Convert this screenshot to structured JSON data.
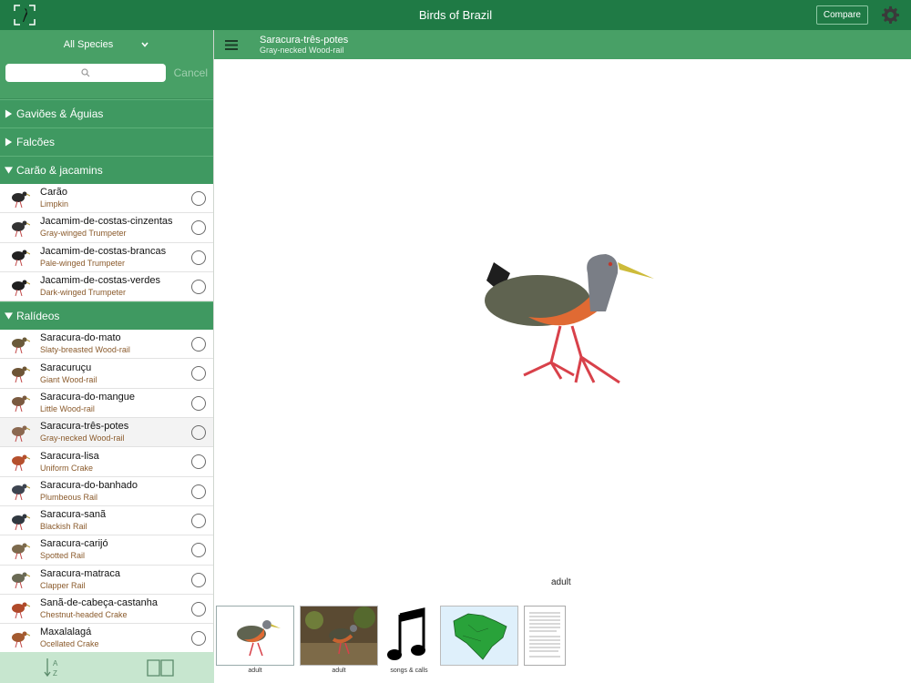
{
  "header": {
    "title": "Birds of Brazil",
    "compare_label": "Compare"
  },
  "sidebar": {
    "filter_label": "All Species",
    "search_placeholder": "",
    "cancel_label": "Cancel",
    "groups": [
      {
        "label": "Gaviões & Águias",
        "expanded": false,
        "items": []
      },
      {
        "label": "Falcões",
        "expanded": false,
        "items": []
      },
      {
        "label": "Carão & jacamins",
        "expanded": true,
        "items": [
          {
            "pt": "Carão",
            "en": "Limpkin"
          },
          {
            "pt": "Jacamim-de-costas-cinzentas",
            "en": "Gray-winged Trumpeter"
          },
          {
            "pt": "Jacamim-de-costas-brancas",
            "en": "Pale-winged Trumpeter"
          },
          {
            "pt": "Jacamim-de-costas-verdes",
            "en": "Dark-winged Trumpeter"
          }
        ]
      },
      {
        "label": "Ralídeos",
        "expanded": true,
        "items": [
          {
            "pt": "Saracura-do-mato",
            "en": "Slaty-breasted Wood-rail"
          },
          {
            "pt": "Saracuruçu",
            "en": "Giant Wood-rail"
          },
          {
            "pt": "Saracura-do-mangue",
            "en": "Little Wood-rail"
          },
          {
            "pt": "Saracura-três-potes",
            "en": "Gray-necked Wood-rail",
            "selected": true
          },
          {
            "pt": "Saracura-lisa",
            "en": "Uniform Crake"
          },
          {
            "pt": "Saracura-do-banhado",
            "en": "Plumbeous Rail"
          },
          {
            "pt": "Saracura-sanã",
            "en": "Blackish Rail"
          },
          {
            "pt": "Saracura-carijó",
            "en": "Spotted Rail"
          },
          {
            "pt": "Saracura-matraca",
            "en": "Clapper Rail"
          },
          {
            "pt": "Sanã-de-cabeça-castanha",
            "en": "Chestnut-headed Crake"
          },
          {
            "pt": "Maxalalagá",
            "en": "Ocellated Crake"
          }
        ]
      }
    ]
  },
  "main": {
    "species_pt": "Saracura-três-potes",
    "species_en": "Gray-necked Wood-rail",
    "image_caption": "adult",
    "thumbnails": [
      {
        "kind": "illustration",
        "caption": "adult"
      },
      {
        "kind": "photo",
        "caption": "adult"
      },
      {
        "kind": "sound",
        "caption": "songs & calls"
      },
      {
        "kind": "map",
        "caption": ""
      },
      {
        "kind": "text",
        "caption": ""
      }
    ]
  },
  "colors": {
    "bar_dark": "#1f7a45",
    "bar_mid": "#48a066",
    "group": "#3f9961",
    "english_name": "#8a5a2b"
  }
}
